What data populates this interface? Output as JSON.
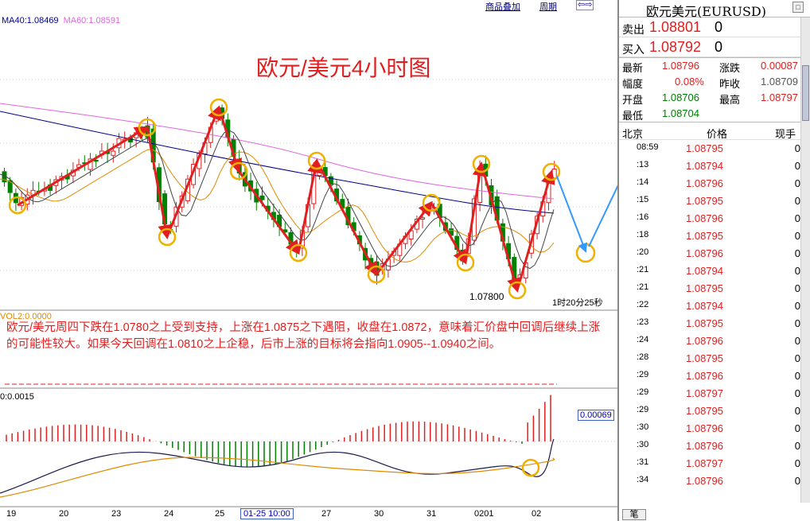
{
  "toolbar": {
    "overlay_link": "商品叠加",
    "period_link": "周期",
    "nav_arrows": "⇦⇨"
  },
  "legend": {
    "ma40": "MA40:1.08469",
    "ma60": "MA60:1.08591"
  },
  "title": "欧元/美元4小时图",
  "low_label": "1.07800",
  "time_left": "1时20分25秒",
  "vol_label": "VOL2:0.0000",
  "commentary": "欧元/美元周四下跌在1.0780之上受到支持，上涨在1.0875之下遇阻，收盘在1.0872，意味着汇价盘中回调后继续上涨的可能性较大。如果今天回调在1.0810之上企稳，后市上涨的目标将会指向1.0905--1.0940之间。",
  "macd_label": "0:0.0015",
  "macd_value": "0.00069",
  "dates": [
    "19",
    "20",
    "23",
    "24",
    "25",
    "27",
    "30",
    "31",
    "0201",
    "02"
  ],
  "cursor_date": "01-25 10:00",
  "colors": {
    "up": "#e02020",
    "down": "#008000",
    "accent": "#e02020",
    "annotation": "#f0b000",
    "forecast": "#3399ff"
  },
  "quote": {
    "title": "欧元美元(EURUSD)",
    "sell_label": "卖出",
    "sell_price": "1.08801",
    "sell_vol": "0",
    "buy_label": "买入",
    "buy_price": "1.08792",
    "buy_vol": "0",
    "latest_label": "最新",
    "latest": "1.08796",
    "change_label": "涨跌",
    "change": "0.00087",
    "range_label": "幅度",
    "range": "0.08%",
    "prev_label": "昨收",
    "prev": "1.08709",
    "open_label": "开盘",
    "open": "1.08706",
    "high_label": "最高",
    "high": "1.08797",
    "low_label": "最低",
    "low": "1.08704",
    "col_time": "北京",
    "col_price": "价格",
    "col_vol": "现手",
    "tab_label": "笔",
    "ticks": [
      {
        "t": "08:59",
        "p": "1.08795",
        "v": "0"
      },
      {
        "t": ":13",
        "p": "1.08794",
        "v": "0"
      },
      {
        "t": ":14",
        "p": "1.08796",
        "v": "0"
      },
      {
        "t": ":15",
        "p": "1.08795",
        "v": "0"
      },
      {
        "t": ":16",
        "p": "1.08796",
        "v": "0"
      },
      {
        "t": ":18",
        "p": "1.08795",
        "v": "0"
      },
      {
        "t": ":20",
        "p": "1.08796",
        "v": "0"
      },
      {
        "t": ":21",
        "p": "1.08794",
        "v": "0"
      },
      {
        "t": ":21",
        "p": "1.08795",
        "v": "0"
      },
      {
        "t": ":22",
        "p": "1.08794",
        "v": "0"
      },
      {
        "t": ":23",
        "p": "1.08795",
        "v": "0"
      },
      {
        "t": ":24",
        "p": "1.08796",
        "v": "0"
      },
      {
        "t": ":28",
        "p": "1.08795",
        "v": "0"
      },
      {
        "t": ":29",
        "p": "1.08796",
        "v": "0"
      },
      {
        "t": ":29",
        "p": "1.08797",
        "v": "0"
      },
      {
        "t": ":29",
        "p": "1.08795",
        "v": "0"
      },
      {
        "t": ":30",
        "p": "1.08796",
        "v": "0"
      },
      {
        "t": ":30",
        "p": "1.08796",
        "v": "0"
      },
      {
        "t": ":31",
        "p": "1.08797",
        "v": "0"
      },
      {
        "t": ":34",
        "p": "1.08796",
        "v": "0"
      }
    ]
  }
}
